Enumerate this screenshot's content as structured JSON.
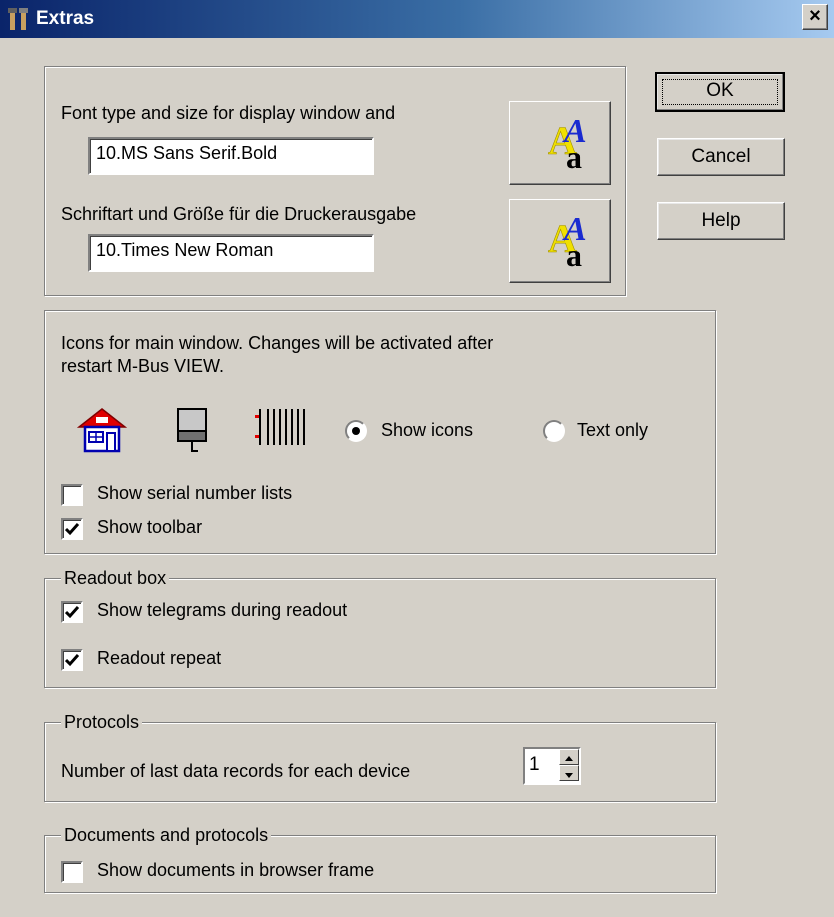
{
  "window": {
    "title": "Extras",
    "close_glyph": "×"
  },
  "buttons": {
    "ok": "OK",
    "cancel": "Cancel",
    "help": "Help"
  },
  "fonts": {
    "display_label": "Font type and size for display window and",
    "display_value": "10.MS Sans Serif.Bold",
    "printer_label": "Schriftart und Größe für die Druckerausgabe",
    "printer_value": "10.Times New Roman",
    "font_button_glyph_top": "A",
    "font_button_glyph_bottom": "a"
  },
  "icons_section": {
    "description_line1": "Icons for main window. Changes will be activated after",
    "description_line2": "restart M-Bus VIEW.",
    "icons": [
      "house-icon",
      "monitor-icon",
      "radiator-icon"
    ],
    "show_icons_label": "Show icons",
    "text_only_label": "Text only",
    "mode_selected": "Show icons",
    "show_serial_lists_label": "Show serial number lists",
    "show_serial_lists_checked": false,
    "show_toolbar_label": "Show toolbar",
    "show_toolbar_checked": true
  },
  "readout": {
    "legend": "Readout box",
    "show_telegrams_label": "Show telegrams during readout",
    "show_telegrams_checked": true,
    "repeat_label": "Readout repeat",
    "repeat_checked": true
  },
  "protocols": {
    "legend": "Protocols",
    "records_label": "Number of last data records for each device",
    "records_value": "1"
  },
  "documents": {
    "legend": "Documents and protocols",
    "browser_frame_label": "Show documents in browser frame",
    "browser_frame_checked": false
  },
  "colors": {
    "title_gradient_start": "#0a246a",
    "title_gradient_end": "#a6caf0",
    "face": "#d4d0c8"
  }
}
